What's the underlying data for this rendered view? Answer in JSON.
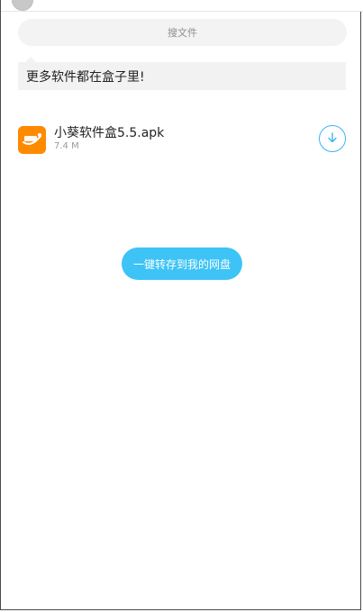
{
  "search": {
    "placeholder": "搜文件"
  },
  "banner": {
    "text": "更多软件都在盒子里!"
  },
  "file": {
    "name": "小葵软件盒5.5.apk",
    "size": "7.4 M",
    "icon": "orange-app-box-icon"
  },
  "actions": {
    "save_label": "一键转存到我的网盘",
    "download_icon": "download-arrow-icon"
  },
  "colors": {
    "accent": "#3ec3f6",
    "icon_bg": "#ff8a00",
    "search_bg": "#f3f3f3",
    "banner_bg": "#f2f2f2"
  }
}
